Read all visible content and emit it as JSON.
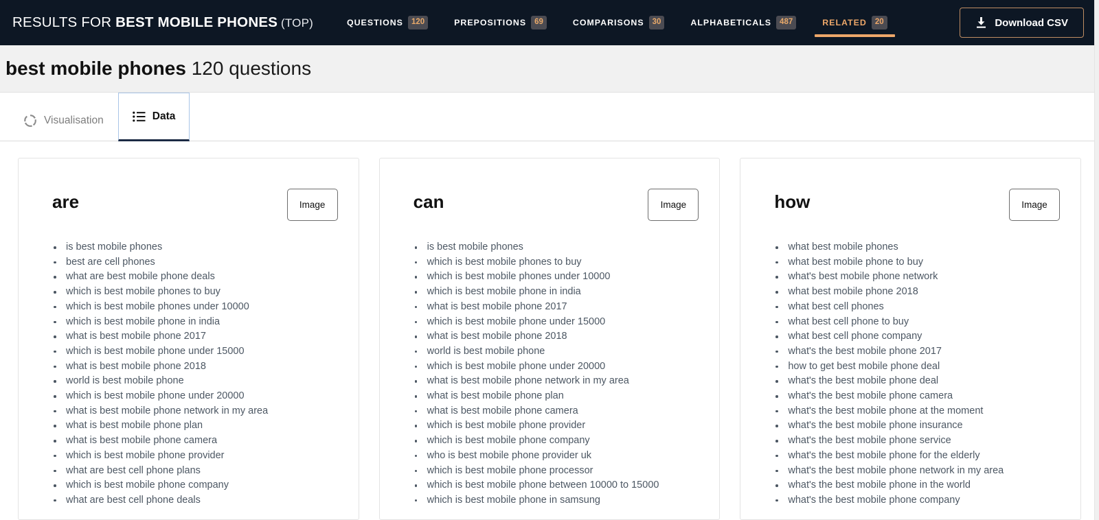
{
  "topbar": {
    "title_prefix": "RESULTS FOR ",
    "keyword": "BEST MOBILE PHONES",
    "title_suffix": " (TOP)",
    "tabs": [
      {
        "label": "QUESTIONS",
        "count": "120",
        "active": false
      },
      {
        "label": "PREPOSITIONS",
        "count": "69",
        "active": false
      },
      {
        "label": "COMPARISONS",
        "count": "30",
        "active": false
      },
      {
        "label": "ALPHABETICALS",
        "count": "487",
        "active": false
      },
      {
        "label": "RELATED",
        "count": "20",
        "active": true
      }
    ],
    "download_label": "Download CSV",
    "accent_color": "#eda769",
    "bg_color": "#0d1724",
    "badge_bg": "#4b4b52"
  },
  "page_header": {
    "keyword": "best mobile phones",
    "count_text": "120 questions"
  },
  "view_tabs": [
    {
      "label": "Visualisation",
      "icon": "donut-icon",
      "active": false
    },
    {
      "label": "Data",
      "icon": "list-icon",
      "active": true
    }
  ],
  "cards": [
    {
      "title": "are",
      "image_button_label": "Image",
      "items": [
        "is best mobile phones",
        "best are cell phones",
        "what are best mobile phone deals",
        "which is best mobile phones to buy",
        "which is best mobile phones under 10000",
        "which is best mobile phone in india",
        "what is best mobile phone 2017",
        "which is best mobile phone under 15000",
        "what is best mobile phone 2018",
        "world is best mobile phone",
        "which is best mobile phone under 20000",
        "what is best mobile phone network in my area",
        "what is best mobile phone plan",
        "what is best mobile phone camera",
        "which is best mobile phone provider",
        "what are best cell phone plans",
        "which is best mobile phone company",
        "what are best cell phone deals"
      ]
    },
    {
      "title": "can",
      "image_button_label": "Image",
      "items": [
        "is best mobile phones",
        "which is best mobile phones to buy",
        "which is best mobile phones under 10000",
        "which is best mobile phone in india",
        "what is best mobile phone 2017",
        "which is best mobile phone under 15000",
        "what is best mobile phone 2018",
        "world is best mobile phone",
        "which is best mobile phone under 20000",
        "what is best mobile phone network in my area",
        "what is best mobile phone plan",
        "what is best mobile phone camera",
        "which is best mobile phone provider",
        "which is best mobile phone company",
        "who is best mobile phone provider uk",
        "which is best mobile phone processor",
        "which is best mobile phone between 10000 to 15000",
        "which is best mobile phone in samsung"
      ]
    },
    {
      "title": "how",
      "image_button_label": "Image",
      "items": [
        "what best mobile phones",
        "what best mobile phone to buy",
        "what's best mobile phone network",
        "what best mobile phone 2018",
        "what best cell phones",
        "what best cell phone to buy",
        "what best cell phone company",
        "what's the best mobile phone 2017",
        "how to get best mobile phone deal",
        "what's the best mobile phone deal",
        "what's the best mobile phone camera",
        "what's the best mobile phone at the moment",
        "what's the best mobile phone insurance",
        "what's the best mobile phone service",
        "what's the best mobile phone for the elderly",
        "what's the best mobile phone network in my area",
        "what's the best mobile phone in the world",
        "what's the best mobile phone company"
      ]
    }
  ]
}
